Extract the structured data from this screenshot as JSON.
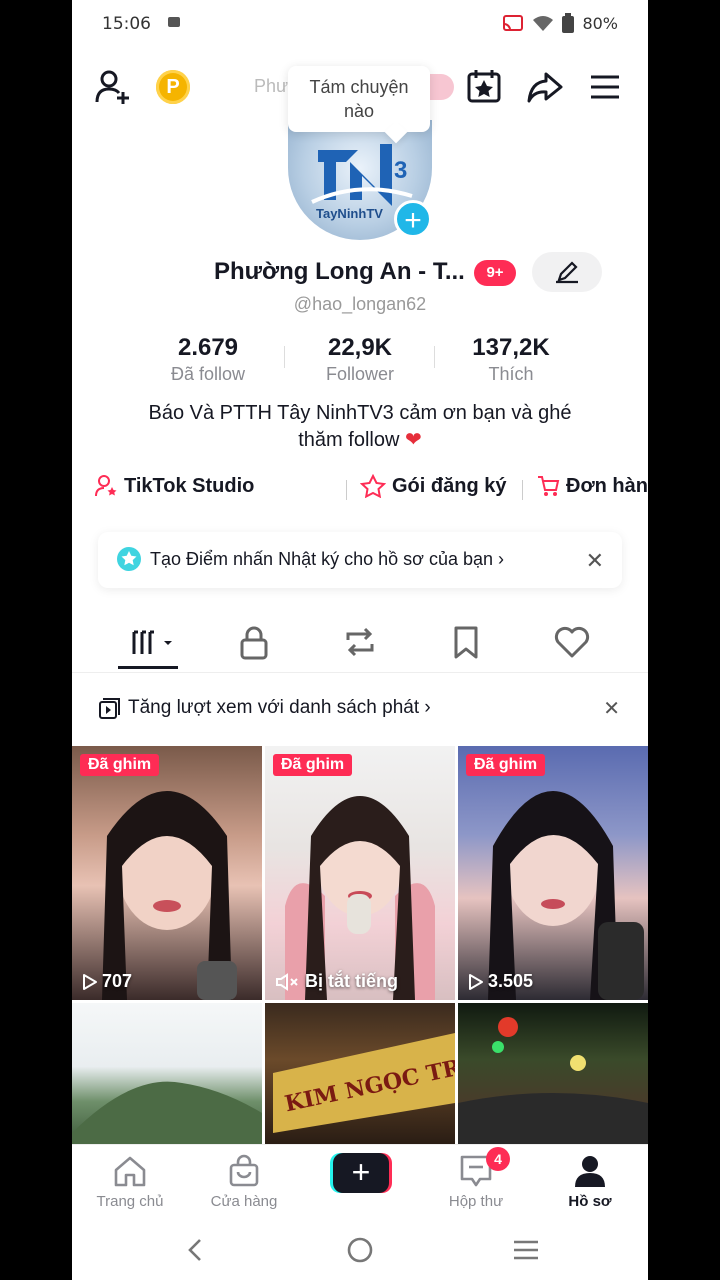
{
  "status": {
    "time": "15:06",
    "battery": "80%"
  },
  "topbar": {
    "faded_title": "Phường Long An",
    "tooltip": [
      "Tám chuyện",
      "nào"
    ],
    "coin_label": "P"
  },
  "profile": {
    "avatar_text": "TayNinhTV",
    "name": "Phường Long An - T...",
    "badge": "9+",
    "handle": "@hao_longan62",
    "stats": [
      {
        "value": "2.679",
        "label": "Đã follow"
      },
      {
        "value": "22,9K",
        "label": "Follower"
      },
      {
        "value": "137,2K",
        "label": "Thích"
      }
    ],
    "bio_line1": "Báo Và PTTH Tây NinhTV3 cảm ơn bạn và ghé",
    "bio_line2": "thăm follow",
    "bio_heart": "❤"
  },
  "links": [
    "TikTok Studio",
    "Gói đăng ký",
    "Đơn hàng của b"
  ],
  "notice": {
    "text": "Tạo Điểm nhấn Nhật ký cho hồ sơ của bạn",
    "chevron": "›",
    "close": "✕"
  },
  "playlist": {
    "text": "Tăng lượt xem với danh sách phát",
    "chevron": "›",
    "close": "✕"
  },
  "videos": [
    {
      "pinned": "Đã ghim",
      "meta": "707",
      "mode": "views"
    },
    {
      "pinned": "Đã ghim",
      "meta": "Bị tắt tiếng",
      "mode": "muted"
    },
    {
      "pinned": "Đã ghim",
      "meta": "3.505",
      "mode": "views"
    },
    {
      "pinned": "",
      "meta": "",
      "mode": "none"
    },
    {
      "pinned": "",
      "meta": "",
      "mode": "none",
      "sign": "KIM NGỌC TRÚ"
    },
    {
      "pinned": "",
      "meta": "",
      "mode": "none"
    }
  ],
  "nav": {
    "home": "Trang chủ",
    "shop": "Cửa hàng",
    "create": "+",
    "inbox": "Hộp thư",
    "inbox_badge": "4",
    "profile": "Hồ sơ"
  },
  "colors": {
    "accent": "#fe2c55",
    "cyan": "#25f4ee",
    "text": "#161823"
  }
}
